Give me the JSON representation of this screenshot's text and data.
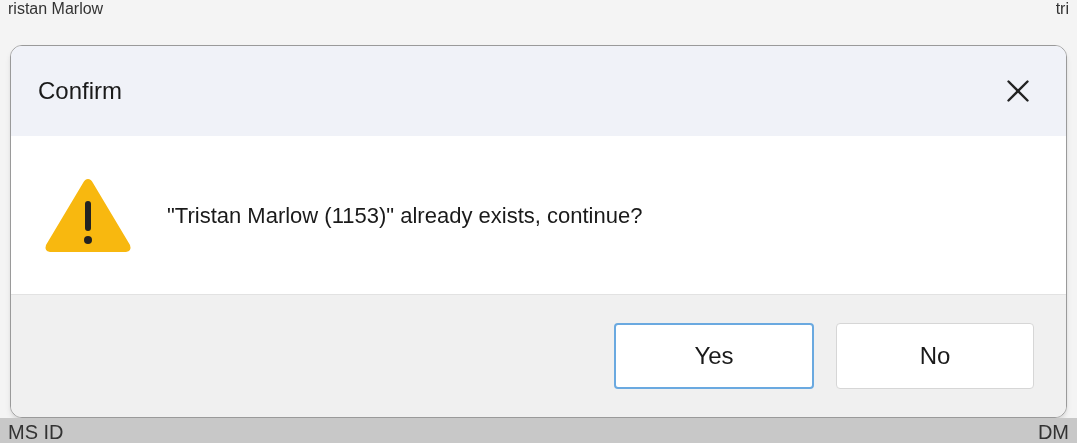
{
  "background": {
    "top_texts": [
      "ristan Marlow",
      "tri"
    ],
    "bottom_texts": [
      "MS ID",
      "DM"
    ]
  },
  "dialog": {
    "title": "Confirm",
    "message": "\"Tristan Marlow (1153)\" already exists, continue?",
    "buttons": [
      {
        "label": "Yes",
        "default": true
      },
      {
        "label": "No",
        "default": false
      }
    ]
  }
}
